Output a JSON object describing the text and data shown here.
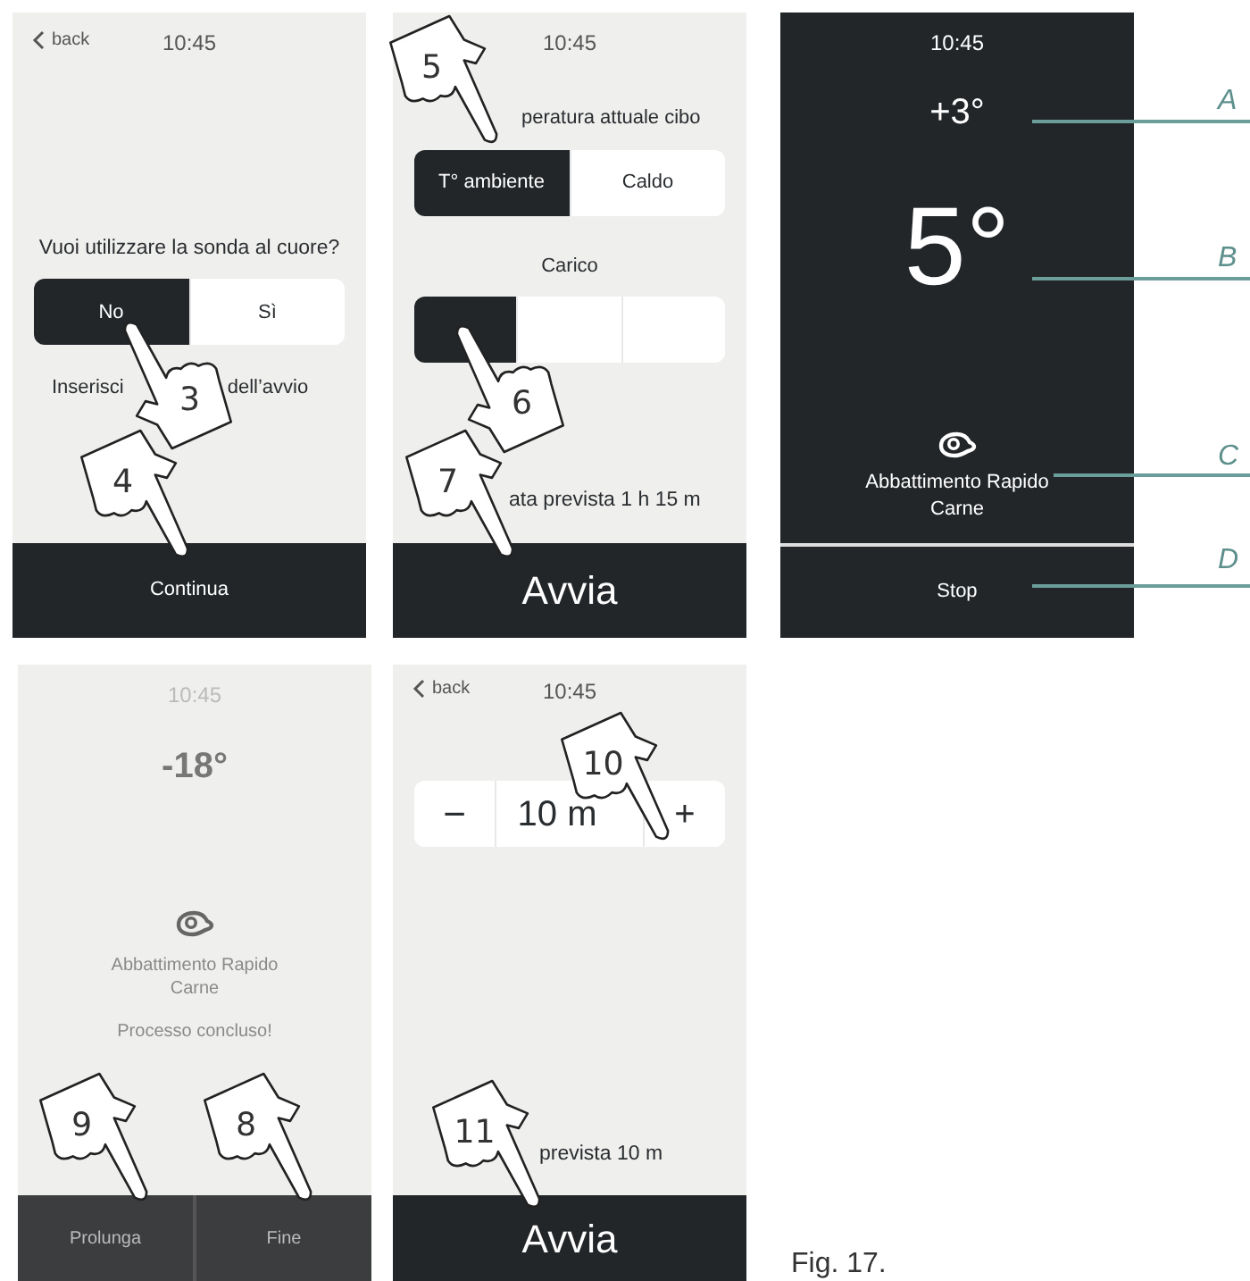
{
  "probe_screen": {
    "back": "back",
    "time": "10:45",
    "question": "Vuoi utilizzare la sonda al cuore?",
    "options": [
      {
        "label": "No",
        "selected": true
      },
      {
        "label": "Sì",
        "selected": false
      }
    ],
    "hint_parts": [
      "Inserisci",
      "dell’avvio"
    ],
    "action": "Continua",
    "pointers": [
      "3",
      "4"
    ]
  },
  "settings_screen": {
    "time": "10:45",
    "temp_label": "peratura attuale cibo",
    "temp_options": [
      {
        "label": "T° ambiente",
        "selected": true
      },
      {
        "label": "Caldo",
        "selected": false
      }
    ],
    "load_label": "Carico",
    "load_options": [
      {
        "selected": true
      },
      {
        "selected": false
      },
      {
        "selected": false
      }
    ],
    "estimate": "ata prevista 1 h 15 m",
    "action": "Avvia",
    "pointers": [
      "5",
      "6",
      "7"
    ]
  },
  "running_screen": {
    "time": "10:45",
    "chamber_temp": "+3°",
    "probe_temp": "5°",
    "program": [
      "Abbattimento Rapido",
      "Carne"
    ],
    "action": "Stop"
  },
  "callouts": [
    "A",
    "B",
    "C",
    "D"
  ],
  "finished_screen": {
    "time": "10:45",
    "temp": "-18°",
    "program": [
      "Abbattimento Rapido",
      "Carne"
    ],
    "status": "Processo concluso!",
    "buttons": [
      "Prolunga",
      "Fine"
    ],
    "pointers": [
      "9",
      "8"
    ]
  },
  "extend_screen": {
    "back": "back",
    "time": "10:45",
    "minus": "−",
    "value": "10 m",
    "plus": "+",
    "estimate": "prevista 10 m",
    "action": "Avvia",
    "pointers": [
      "10",
      "11"
    ]
  },
  "caption": "Fig. 17."
}
